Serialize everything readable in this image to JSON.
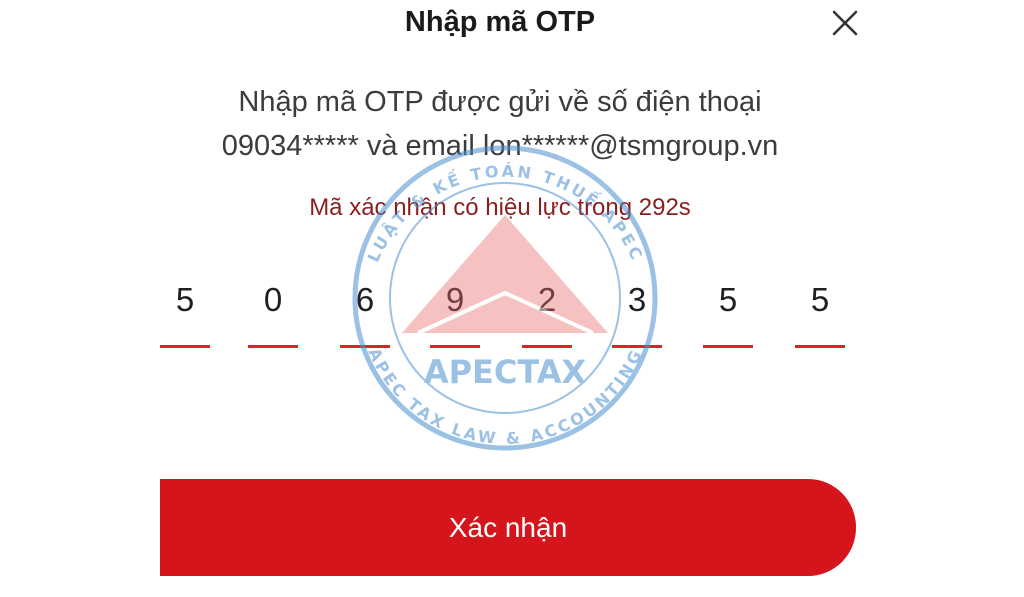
{
  "dialog": {
    "title": "Nhập mã OTP",
    "close_icon": "close-icon",
    "description_line1": "Nhập mã OTP được gửi về số điện thoại",
    "description_line2": "09034***** và email lon******@tsmgroup.vn",
    "validity_text": "Mã xác nhận có hiệu lực trong 292s",
    "otp_digits": [
      "5",
      "0",
      "6",
      "9",
      "2",
      "3",
      "5",
      "5"
    ],
    "confirm_label": "Xác nhận"
  },
  "watermark": {
    "text_top": "LUẬT & KẾ TOÁN THUẾ APEC",
    "text_bottom": "APEC TAX LAW & ACCOUNTING",
    "brand": "APECTAX"
  },
  "colors": {
    "accent": "#d4161c",
    "underline": "#d8252a",
    "validity": "#8a1f1f",
    "watermark_blue": "#4a90d0",
    "watermark_red": "#e86a6a"
  }
}
